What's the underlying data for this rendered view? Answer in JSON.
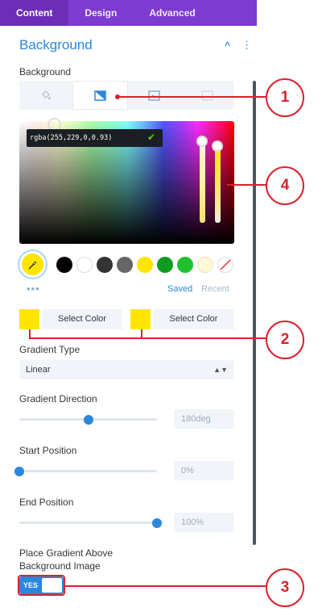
{
  "tabs": [
    {
      "label": "Content"
    },
    {
      "label": "Design"
    },
    {
      "label": "Advanced"
    }
  ],
  "section": {
    "title": "Background"
  },
  "background": {
    "label": "Background",
    "type_tabs": [
      "color-icon",
      "gradient-icon",
      "image-icon",
      "video-icon"
    ]
  },
  "picker": {
    "value": "rgba(255,229,0,0.93)",
    "selected_color": "#ffe500"
  },
  "swatches": [
    "#000000",
    "#ffffff",
    "#333333",
    "#666666",
    "#ffe500",
    "#0f9b20",
    "#1fc12f",
    "#fff8d6",
    "transparent"
  ],
  "picker_footer": {
    "dots": "•••",
    "saved": "Saved",
    "recent": "Recent"
  },
  "gradient_stops": [
    {
      "button": "Select Color",
      "color": "#ffe500"
    },
    {
      "button": "Select Color",
      "color": "#ffe500"
    }
  ],
  "gradient_type": {
    "label": "Gradient Type",
    "value": "Linear"
  },
  "gradient_direction": {
    "label": "Gradient Direction",
    "value": "180deg",
    "slider_percent": 50
  },
  "start_position": {
    "label": "Start Position",
    "value": "0%",
    "slider_percent": 0
  },
  "end_position": {
    "label": "End Position",
    "value": "100%",
    "slider_percent": 100
  },
  "place_above": {
    "label_line1": "Place Gradient Above",
    "label_line2": "Background Image",
    "toggle": "YES"
  },
  "callouts": [
    "1",
    "2",
    "3",
    "4"
  ],
  "colors": {
    "accent": "#2b87da",
    "tabs_bg": "#7e3bd0",
    "callout": "#d9232d"
  }
}
